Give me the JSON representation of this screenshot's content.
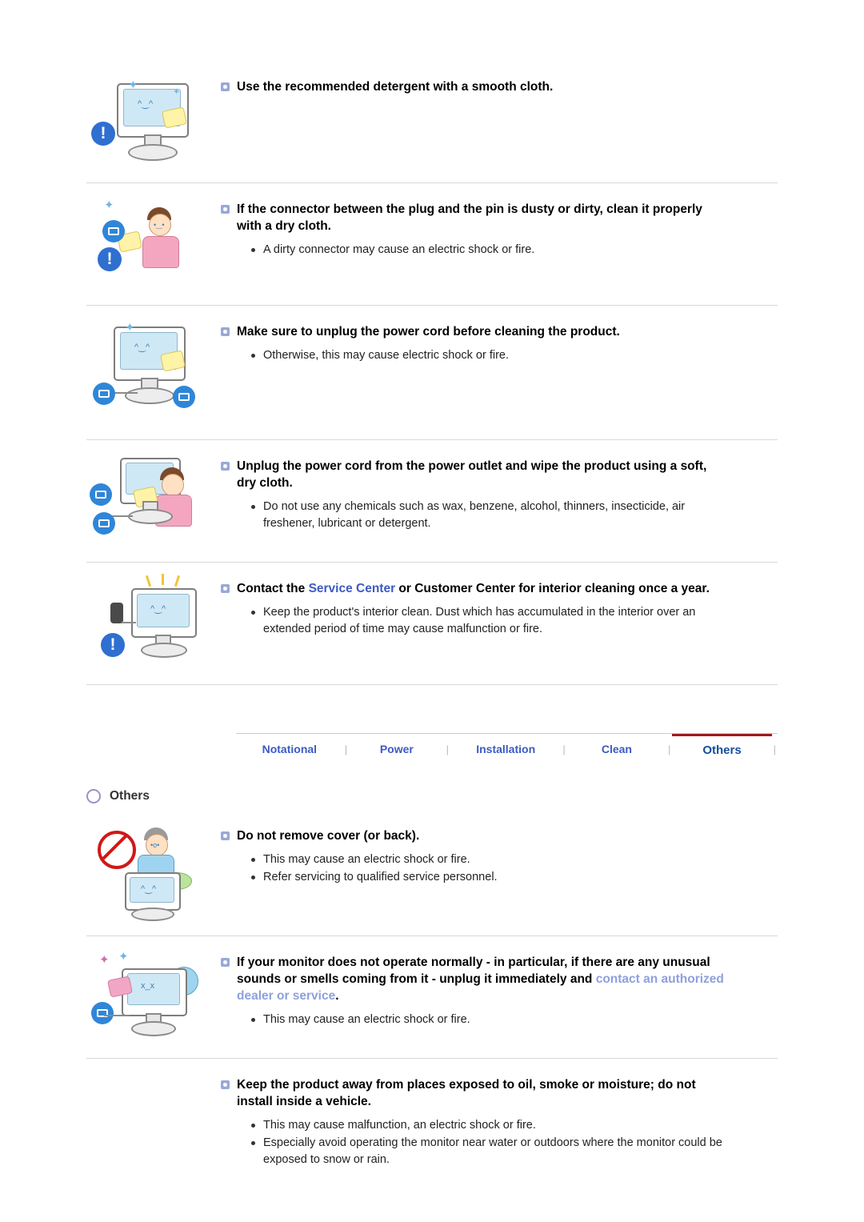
{
  "sections": [
    {
      "heading_plain": "Use the recommended detergent with a smooth cloth.",
      "bullets": []
    },
    {
      "heading_plain": "If the connector between the plug and the pin is dusty or dirty, clean it properly with a dry cloth.",
      "bullets": [
        "A dirty connector may cause an electric shock or fire."
      ]
    },
    {
      "heading_plain": "Make sure to unplug the power cord before cleaning the product.",
      "bullets": [
        "Otherwise, this may cause electric shock or fire."
      ]
    },
    {
      "heading_plain": "Unplug the power cord from the power outlet and wipe the product using a soft, dry cloth.",
      "bullets": [
        "Do not use any chemicals such as wax, benzene, alcohol, thinners, insecticide, air freshener, lubricant or detergent."
      ]
    },
    {
      "heading_pre": "Contact the ",
      "heading_link": "Service Center",
      "heading_post": " or Customer Center for interior cleaning once a year.",
      "bullets": [
        "Keep the product's interior clean. Dust which has accumulated in the interior over an extended period of time may cause malfunction or fire."
      ]
    }
  ],
  "tabs": [
    {
      "label": "Notational",
      "active": false
    },
    {
      "label": "Power",
      "active": false
    },
    {
      "label": "Installation",
      "active": false
    },
    {
      "label": "Clean",
      "active": false
    },
    {
      "label": "Others",
      "active": true
    }
  ],
  "tab_separator": "|",
  "section_title": "Others",
  "others_sections": [
    {
      "heading_plain": "Do not remove cover (or back).",
      "bullets": [
        "This may cause an electric shock or fire.",
        "Refer servicing to qualified service personnel."
      ]
    },
    {
      "heading_pre": "If your monitor does not operate normally - in particular, if there are any unusual sounds or smells coming from it - unplug it immediately and ",
      "heading_soft": "contact an authorized dealer or service",
      "heading_post": ".",
      "bullets": [
        "This may cause an electric shock or fire."
      ]
    },
    {
      "heading_plain": "Keep the product away from places exposed to oil, smoke or moisture; do not install inside a vehicle.",
      "bullets": [
        "This may cause malfunction, an electric shock or fire.",
        "Especially avoid operating the monitor near water or outdoors where the monitor could be exposed to snow or rain."
      ]
    }
  ],
  "icons": {
    "warn_glyph": "!",
    "sparkle_glyph": "✦"
  },
  "colors": {
    "link": "#3b5ac4",
    "soft_link": "#8fa0dd",
    "active_tab_underline": "#a31818",
    "bullet_square": "#9aa8d8"
  }
}
